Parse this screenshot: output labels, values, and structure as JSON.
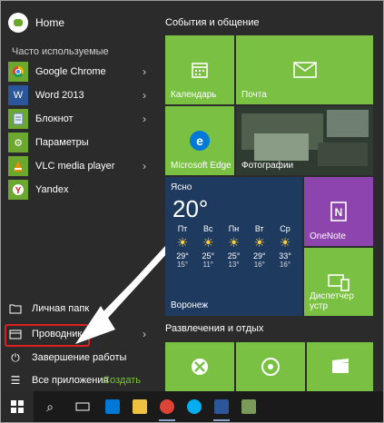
{
  "left": {
    "user": "Home",
    "section_label": "Часто используемые",
    "apps": [
      {
        "label": "Google Chrome",
        "has_arrow": true,
        "icon": "chrome-icon"
      },
      {
        "label": "Word 2013",
        "has_arrow": true,
        "icon": "word-icon"
      },
      {
        "label": "Блокнот",
        "has_arrow": true,
        "icon": "notepad-icon"
      },
      {
        "label": "Параметры",
        "has_arrow": false,
        "icon": "gear-icon"
      },
      {
        "label": "VLC media player",
        "has_arrow": true,
        "icon": "vlc-icon"
      },
      {
        "label": "Yandex",
        "has_arrow": false,
        "icon": "yandex-icon"
      }
    ],
    "bottom": {
      "personal": "Личная папк",
      "explorer": "Проводник",
      "shutdown": "Завершение работы",
      "all_apps": "Все приложения",
      "create": "Создать"
    }
  },
  "right": {
    "group1_title": "События и общение",
    "group2_title": "Развлечения и отдых",
    "tiles": {
      "calendar": "Календарь",
      "mail": "Почта",
      "edge": "Microsoft Edge",
      "photos": "Фотографии",
      "onenote": "OneNote",
      "device_manager": "Диспетчер устр"
    },
    "weather": {
      "label": "Ясно",
      "temp": "20°",
      "city": "Воронеж",
      "days": [
        {
          "d": "Пт",
          "hi": "29°",
          "lo": "15°"
        },
        {
          "d": "Вс",
          "hi": "25°",
          "lo": "11°"
        },
        {
          "d": "Пн",
          "hi": "25°",
          "lo": "13°"
        },
        {
          "d": "Вт",
          "hi": "29°",
          "lo": "16°"
        },
        {
          "d": "Ср",
          "hi": "33°",
          "lo": "16°"
        }
      ]
    }
  },
  "colors": {
    "tile_green": "#7ac143",
    "tile_blue": "#0078d7",
    "tile_purple": "#8e44ad",
    "weather_bg": "#1f3a5f",
    "highlight": "#e02020"
  }
}
